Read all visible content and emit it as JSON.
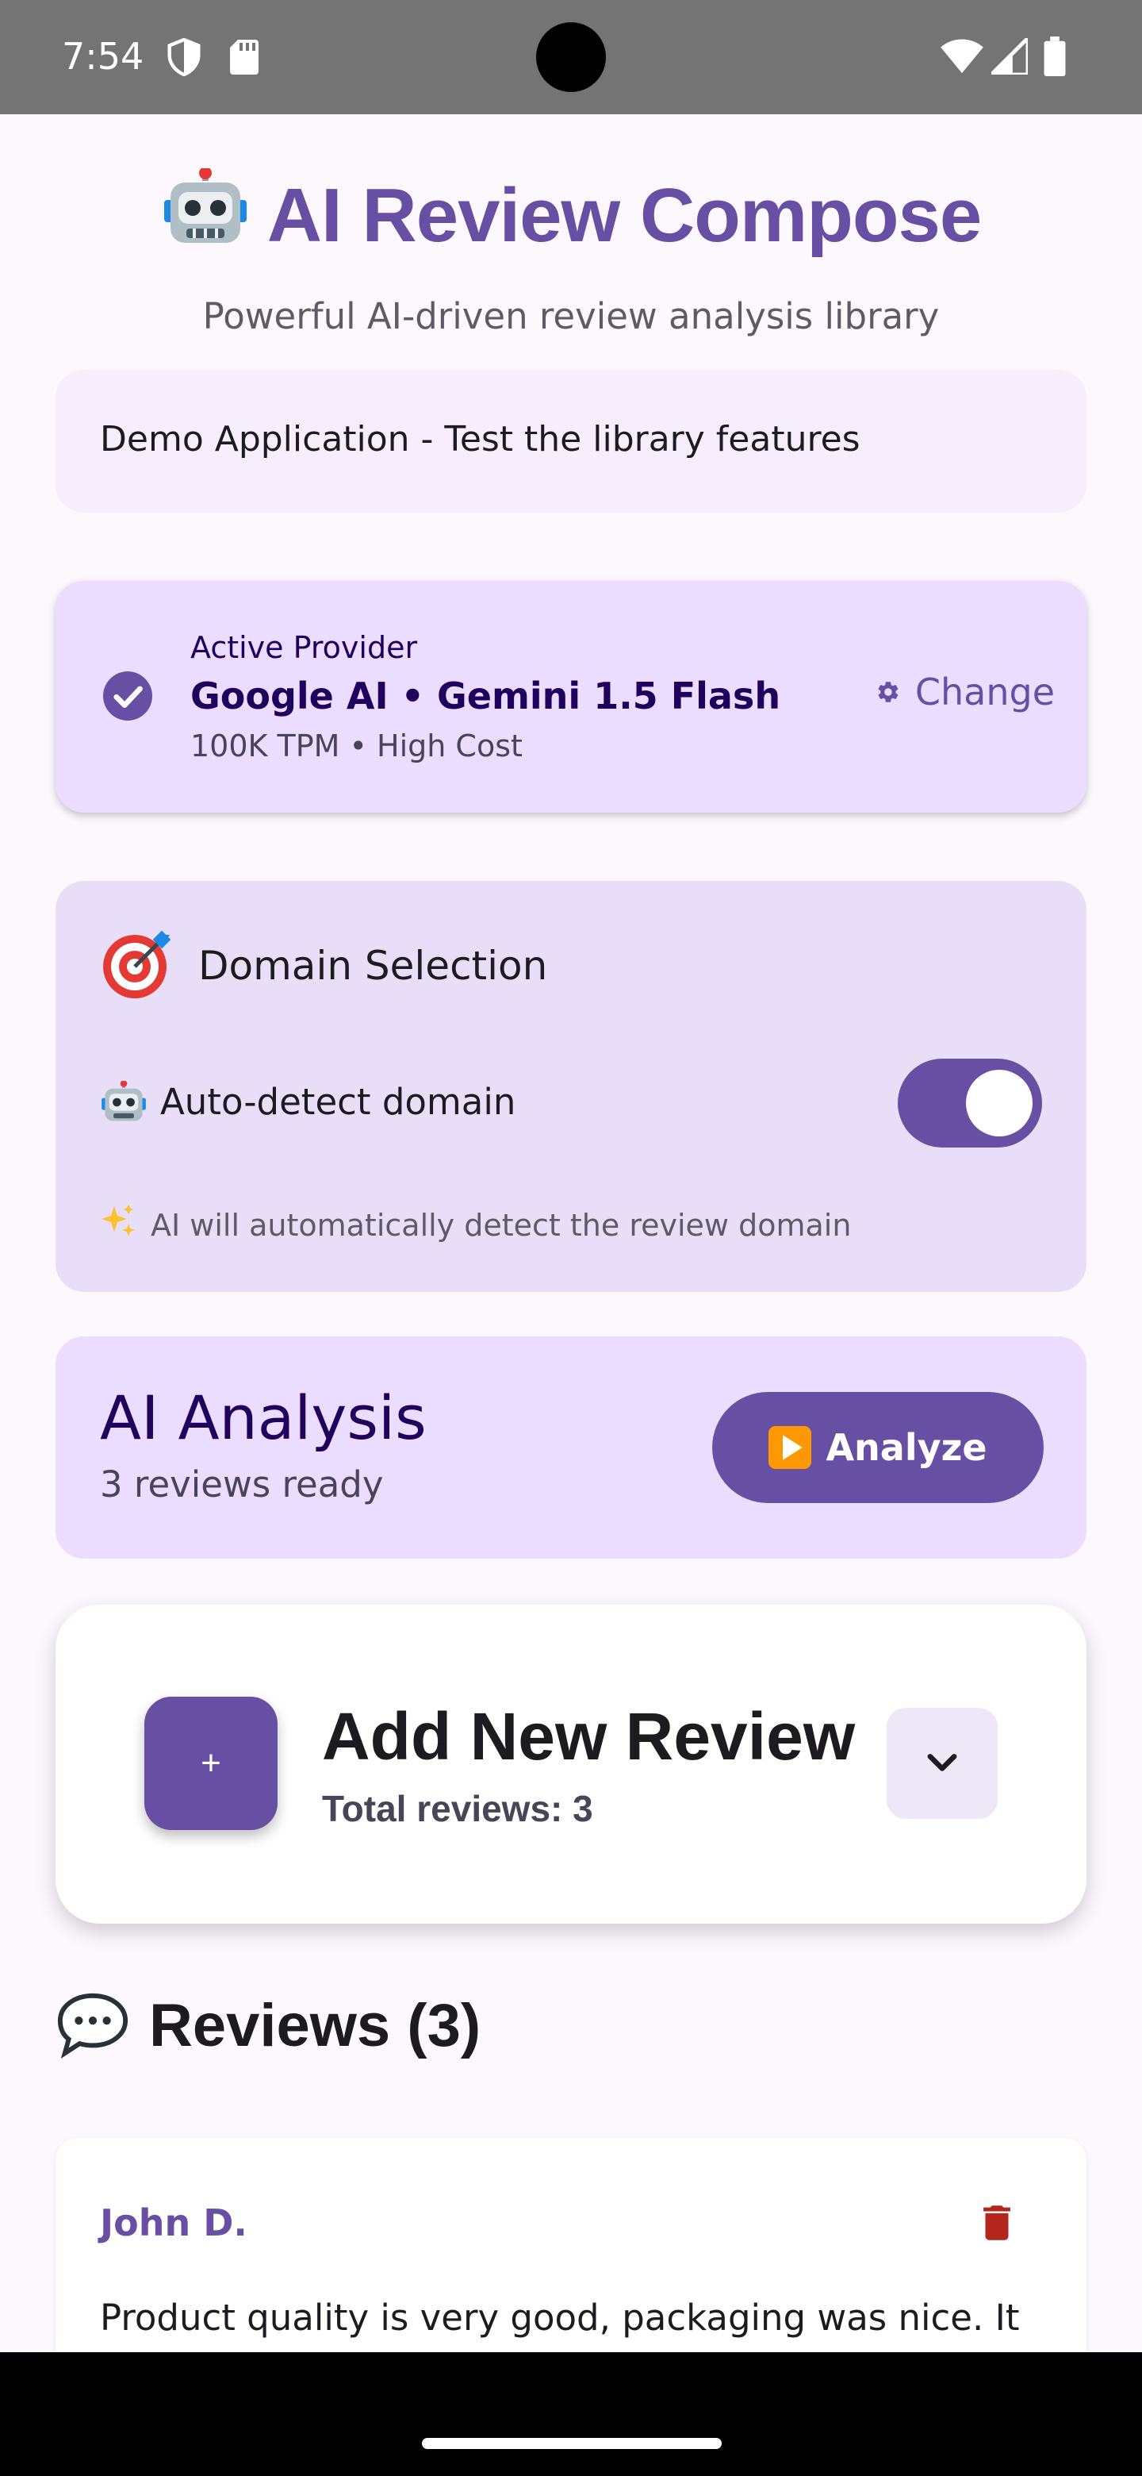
{
  "status_bar": {
    "time": "7:54",
    "icons": [
      "shield-icon",
      "sd-card-icon",
      "wifi-icon",
      "signal-icon",
      "battery-icon"
    ]
  },
  "header": {
    "title": "AI Review Compose",
    "title_icon": "robot-emoji-icon",
    "subtitle": "Powerful AI-driven review analysis library",
    "demo_text": "Demo Application - Test the library features"
  },
  "provider": {
    "label": "Active Provider",
    "name": "Google AI • Gemini 1.5 Flash",
    "meta": "100K TPM • High Cost",
    "change_label": "Change"
  },
  "domain": {
    "title": "Domain Selection",
    "auto_label": "Auto-detect domain",
    "auto_enabled": true,
    "hint": "AI will automatically detect the review domain"
  },
  "analysis": {
    "title": "AI Analysis",
    "subtitle": "3 reviews ready",
    "button_label": "Analyze"
  },
  "add_review": {
    "fab_label": "+",
    "title": "Add New Review",
    "subtitle": "Total reviews: 3"
  },
  "reviews": {
    "header": "Reviews (3)",
    "items": [
      {
        "author": "John D.",
        "text": "Product quality is very good, packaging was nice. It"
      }
    ]
  },
  "colors": {
    "primary": "#6750A4",
    "background": "#FDF7FE",
    "delete": "#B3261E"
  }
}
